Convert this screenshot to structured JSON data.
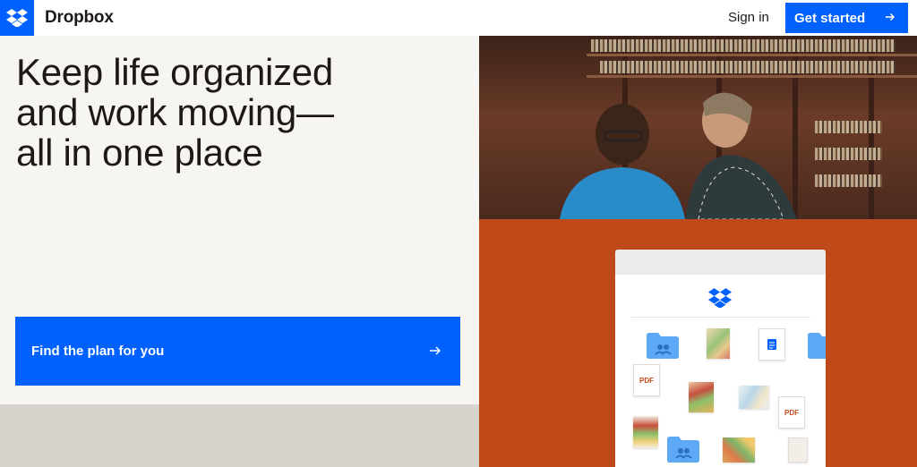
{
  "header": {
    "brand": "Dropbox",
    "sign_in": "Sign in",
    "get_started": "Get started"
  },
  "hero": {
    "headline_lines": [
      "Keep life organized",
      "and work moving—",
      "all in one place"
    ],
    "cta_label": "Find the plan for you"
  },
  "card": {
    "pdf_label": "PDF"
  },
  "colors": {
    "brand_blue": "#0061fe",
    "hero_bg": "#f7f5f2",
    "panel_orange": "#c0491a",
    "folder_blue": "#5ea9f5"
  },
  "icons": [
    "dropbox-logo-icon",
    "arrow-right-icon",
    "folder-icon",
    "document-icon",
    "pdf-file-icon",
    "image-thumbnail-icon"
  ]
}
